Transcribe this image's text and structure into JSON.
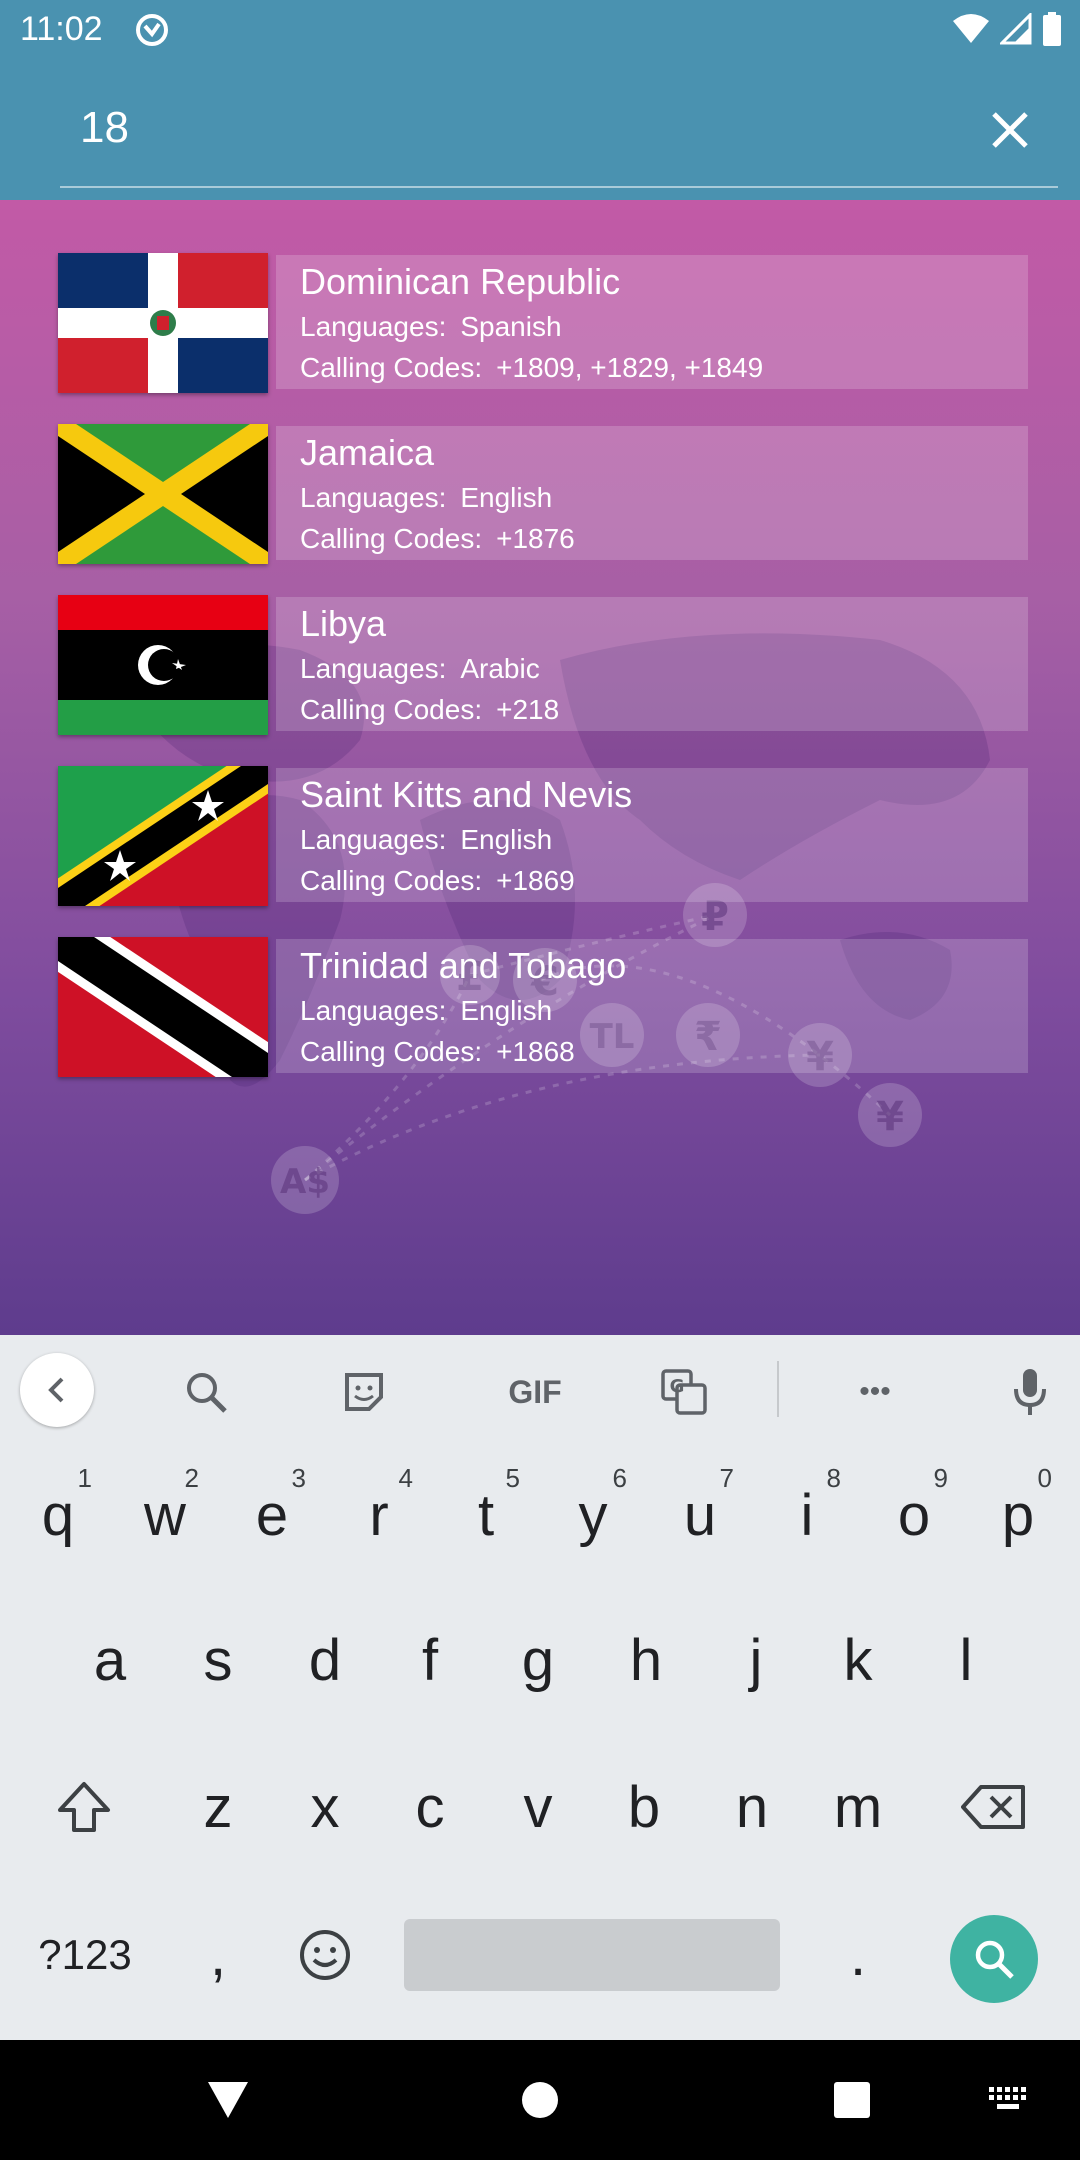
{
  "status_bar": {
    "time": "11:02",
    "icons": [
      "sync-icon",
      "wifi-icon",
      "signal-icon",
      "battery-icon"
    ]
  },
  "search": {
    "value": "18",
    "clear_icon": "close-icon"
  },
  "results": [
    {
      "name": "Dominican Republic",
      "languages_label": "Languages:",
      "languages": "Spanish",
      "codes_label": "Calling Codes:",
      "codes": "+1809, +1829, +1849",
      "flag": "dominican-republic-flag"
    },
    {
      "name": "Jamaica",
      "languages_label": "Languages:",
      "languages": "English",
      "codes_label": "Calling Codes:",
      "codes": "+1876",
      "flag": "jamaica-flag"
    },
    {
      "name": "Libya",
      "languages_label": "Languages:",
      "languages": "Arabic",
      "codes_label": "Calling Codes:",
      "codes": "+218",
      "flag": "libya-flag"
    },
    {
      "name": "Saint Kitts and Nevis",
      "languages_label": "Languages:",
      "languages": "English",
      "codes_label": "Calling Codes:",
      "codes": "+1869",
      "flag": "saint-kitts-and-nevis-flag"
    },
    {
      "name": "Trinidad and Tobago",
      "languages_label": "Languages:",
      "languages": "English",
      "codes_label": "Calling Codes:",
      "codes": "+1868",
      "flag": "trinidad-and-tobago-flag"
    }
  ],
  "background_symbols": [
    "₽",
    "£",
    "€",
    "TL",
    "₹",
    "¥",
    "¥",
    "A$"
  ],
  "keyboard": {
    "toolbar": {
      "gif_label": "GIF",
      "more_label": "•••"
    },
    "row1": [
      {
        "key": "q",
        "hint": "1"
      },
      {
        "key": "w",
        "hint": "2"
      },
      {
        "key": "e",
        "hint": "3"
      },
      {
        "key": "r",
        "hint": "4"
      },
      {
        "key": "t",
        "hint": "5"
      },
      {
        "key": "y",
        "hint": "6"
      },
      {
        "key": "u",
        "hint": "7"
      },
      {
        "key": "i",
        "hint": "8"
      },
      {
        "key": "o",
        "hint": "9"
      },
      {
        "key": "p",
        "hint": "0"
      }
    ],
    "row2": [
      "a",
      "s",
      "d",
      "f",
      "g",
      "h",
      "j",
      "k",
      "l"
    ],
    "row3": [
      "z",
      "x",
      "c",
      "v",
      "b",
      "n",
      "m"
    ],
    "symbols_label": "?123",
    "comma": ",",
    "period": "."
  },
  "colors": {
    "header": "#4a92b0",
    "accent_search_key": "#3fb3a2",
    "gradient_top": "#c25aa6",
    "gradient_bottom": "#5e3c8d"
  }
}
